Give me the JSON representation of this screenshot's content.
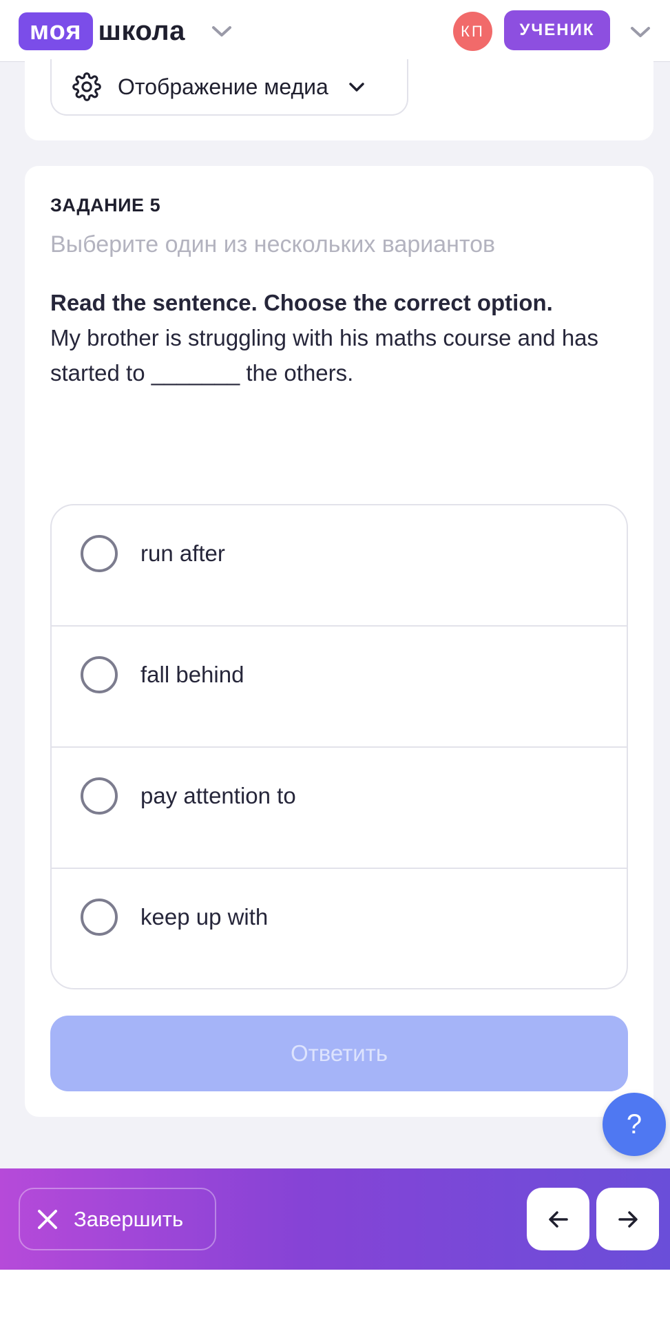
{
  "header": {
    "logo_box": "моя",
    "logo_word": "школа",
    "avatar_initials": "КП",
    "role_badge": "УЧЕНИК"
  },
  "media_toggle": {
    "label": "Отображение медиа"
  },
  "task": {
    "number_label": "ЗАДАНИЕ 5",
    "instruction": "Выберите один из нескольких вариантов",
    "prompt_bold": "Read the sentence. Choose the correct option.",
    "prompt_text": "My brother is struggling with his maths course and has started to _______ the others.",
    "options": [
      {
        "label": "run after",
        "selected": false
      },
      {
        "label": "fall behind",
        "selected": false
      },
      {
        "label": "pay attention to",
        "selected": false
      },
      {
        "label": "keep up with",
        "selected": false
      }
    ],
    "answer_button": "Ответить"
  },
  "help_button": "?",
  "bottom_bar": {
    "finish_label": "Завершить"
  },
  "icons": {
    "logo_chevron": "chevron-down-icon",
    "media": "gear-icon",
    "prev": "arrow-left-icon",
    "next": "arrow-right-icon",
    "finish": "close-icon"
  },
  "colors": {
    "brand_purple": "#7b4de9",
    "avatar_red": "#f16a6a",
    "badge_purple": "#8d4fe0",
    "answer_disabled": "#a5b4f8",
    "help_blue": "#4f78f2"
  }
}
